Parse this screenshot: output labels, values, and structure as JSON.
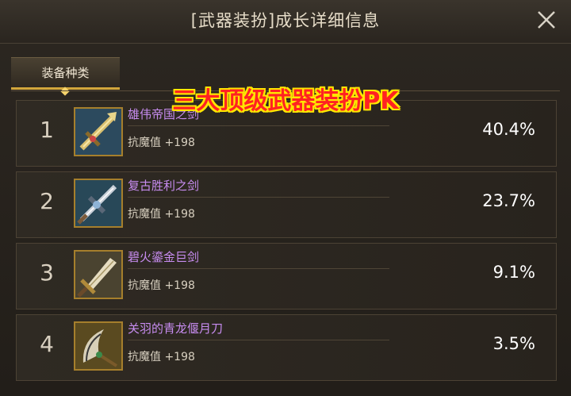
{
  "header": {
    "title": "[武器装扮]成长详细信息"
  },
  "tab": {
    "label": "装备种类"
  },
  "banner": {
    "text": "三大顶级武器装扮PK"
  },
  "rows": [
    {
      "rank": "1",
      "name": "雄伟帝国之剑",
      "stat": "抗魔值 +198",
      "percent": "40.4%",
      "icon": "golden-greatsword-icon"
    },
    {
      "rank": "2",
      "name": "复古胜利之剑",
      "stat": "抗魔值 +198",
      "percent": "23.7%",
      "icon": "silver-sword-icon"
    },
    {
      "rank": "3",
      "name": "碧火鎏金巨剑",
      "stat": "抗魔值 +198",
      "percent": "9.1%",
      "icon": "gilded-greatsword-icon"
    },
    {
      "rank": "4",
      "name": "关羽的青龙偃月刀",
      "stat": "抗魔值 +198",
      "percent": "3.5%",
      "icon": "crescent-blade-icon"
    }
  ],
  "colors": {
    "item_name": "#c78cf0",
    "tab_accent": "#d2a63c",
    "banner_fill": "#ff2222",
    "banner_outline": "#ffe600"
  }
}
